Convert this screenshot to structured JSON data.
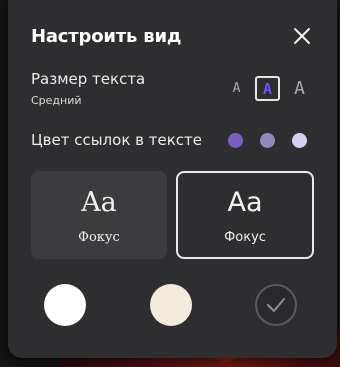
{
  "panel": {
    "title": "Настроить вид",
    "close_icon": "close-icon"
  },
  "text_size": {
    "label": "Размер текста",
    "value": "Средний",
    "options": [
      "A",
      "A",
      "A"
    ],
    "selected_index": 1,
    "selected_color": "#6a53ff"
  },
  "link_color": {
    "label": "Цвет ссылок в тексте",
    "swatches": [
      "#7b5fc0",
      "#8f89bf",
      "#d4d0f2"
    ],
    "selected_index": 0
  },
  "font": {
    "options": [
      {
        "sample": "Aa",
        "name": "Фокус",
        "style": "serif"
      },
      {
        "sample": "Aa",
        "name": "Фокус",
        "style": "sans"
      }
    ],
    "selected_index": 1
  },
  "themes": {
    "swatches": [
      "#ffffff",
      "#f3ecdc",
      "#2a2a2c"
    ],
    "selected_index": 2,
    "check_icon": "check-icon"
  }
}
